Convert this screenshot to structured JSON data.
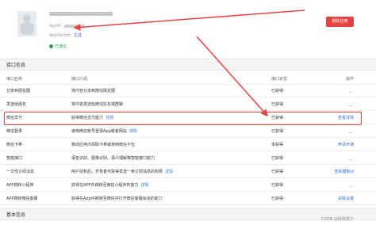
{
  "app": {
    "appid_label": "AppID:",
    "appsecret_label": "AppSecret:",
    "appsecret_action": "生成",
    "status": "已通过",
    "delete_button": "删除应用"
  },
  "sections": {
    "interface": "接口信息",
    "basic": "基本信息"
  },
  "table": {
    "headers": [
      "接口名称",
      "接口介绍",
      "",
      "接口状态",
      "操作"
    ],
    "rows": [
      {
        "name": "分享到朋友圈",
        "desc": "将内容分享到微信朋友圈",
        "desc_link": "",
        "status": "已获得",
        "op": "..."
      },
      {
        "name": "发送给朋友",
        "desc": "将内容发送给微信好友或群聊",
        "desc_link": "",
        "status": "已获得",
        "op": "..."
      },
      {
        "name": "微信支付",
        "desc": "获得微信支付能力",
        "desc_link": "详情",
        "status": "已获得",
        "op": "查看详情"
      },
      {
        "name": "微信登录",
        "desc": "使用微信帐号登录App或者网站",
        "desc_link": "详情",
        "status": "已获得",
        "op": "..."
      },
      {
        "name": "微信卡券",
        "desc": "移动应用内领取卡券或使用微信卡包",
        "desc_link": "",
        "status": "未获得",
        "op": "申请开通"
      },
      {
        "name": "智能接口",
        "desc": "语音识别、图像识别、语义理解等智能接口能力",
        "desc_link": "",
        "status": "已获得",
        "op": "..."
      },
      {
        "name": "一次性订阅消息",
        "desc": "用户授权后，开发者可获得发送一条订阅消息的权限",
        "desc_link": "详情",
        "status": "已获得",
        "op": "查看模板id"
      },
      {
        "name": "APP跳转小程序",
        "desc": "获得在APP中跳转至微信小程序的能力",
        "desc_link": "详情",
        "status": "已获得",
        "op": "..."
      },
      {
        "name": "APP跳转微信客服",
        "desc": "获得在App中跳转至微信并打开微信客服会话的能力",
        "desc_link": "",
        "status": "已获得",
        "op": "关联设置"
      }
    ]
  },
  "watermark": "CSDN @阿政努力",
  "colors": {
    "accent_red": "#e64340",
    "link_blue": "#2e6ed1",
    "success_green": "#27a047"
  },
  "icons": [
    "app-icon",
    "status-check-icon",
    "arrow-annotation"
  ]
}
